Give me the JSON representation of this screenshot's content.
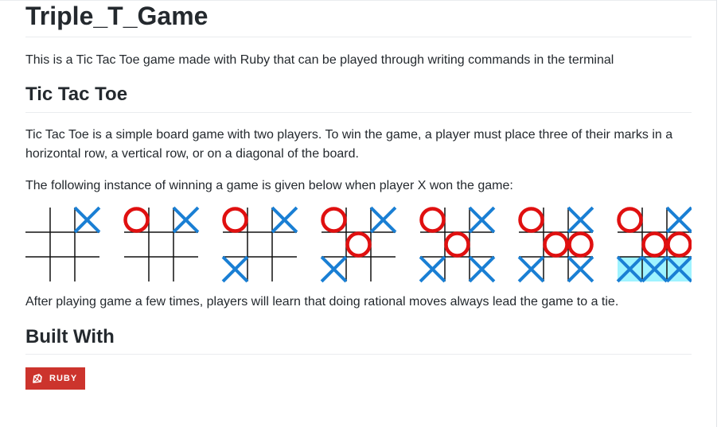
{
  "readme": {
    "title": "Triple_T_Game",
    "intro": "This is a Tic Tac Toe game made with Ruby that can be played through writing commands in the terminal",
    "section_game": {
      "heading": "Tic Tac Toe",
      "description": "Tic Tac Toe is a simple board game with two players. To win the game, a player must place three of their marks in a horizontal row, a vertical row, or on a diagonal of the board.",
      "instance_text": "The following instance of winning a game is given below when player X won the game:",
      "after_text": "After playing game a few times, players will learn that doing rational moves always lead the game to a tie."
    },
    "section_built": {
      "heading": "Built With",
      "badge_label": "RUBY",
      "badge_icon": "ruby-icon"
    }
  },
  "game_sequence": {
    "colors": {
      "x_mark": "#1a7fd4",
      "o_mark": "#e01010",
      "win_highlight": "#9ff3ff",
      "grid": "#111111"
    },
    "boards": [
      {
        "cells": [
          "",
          "",
          "X",
          "",
          "",
          "",
          "",
          "",
          ""
        ],
        "win_row": null
      },
      {
        "cells": [
          "O",
          "",
          "X",
          "",
          "",
          "",
          "",
          "",
          ""
        ],
        "win_row": null
      },
      {
        "cells": [
          "O",
          "",
          "X",
          "",
          "",
          "",
          "X",
          "",
          ""
        ],
        "win_row": null
      },
      {
        "cells": [
          "O",
          "",
          "X",
          "",
          "O",
          "",
          "X",
          "",
          ""
        ],
        "win_row": null
      },
      {
        "cells": [
          "O",
          "",
          "X",
          "",
          "O",
          "",
          "X",
          "",
          "X"
        ],
        "win_row": null
      },
      {
        "cells": [
          "O",
          "",
          "X",
          "",
          "O",
          "O",
          "X",
          "",
          "X"
        ],
        "win_row": null
      },
      {
        "cells": [
          "O",
          "",
          "X",
          "",
          "O",
          "O",
          "X",
          "X",
          "X"
        ],
        "win_row": 2
      }
    ]
  }
}
